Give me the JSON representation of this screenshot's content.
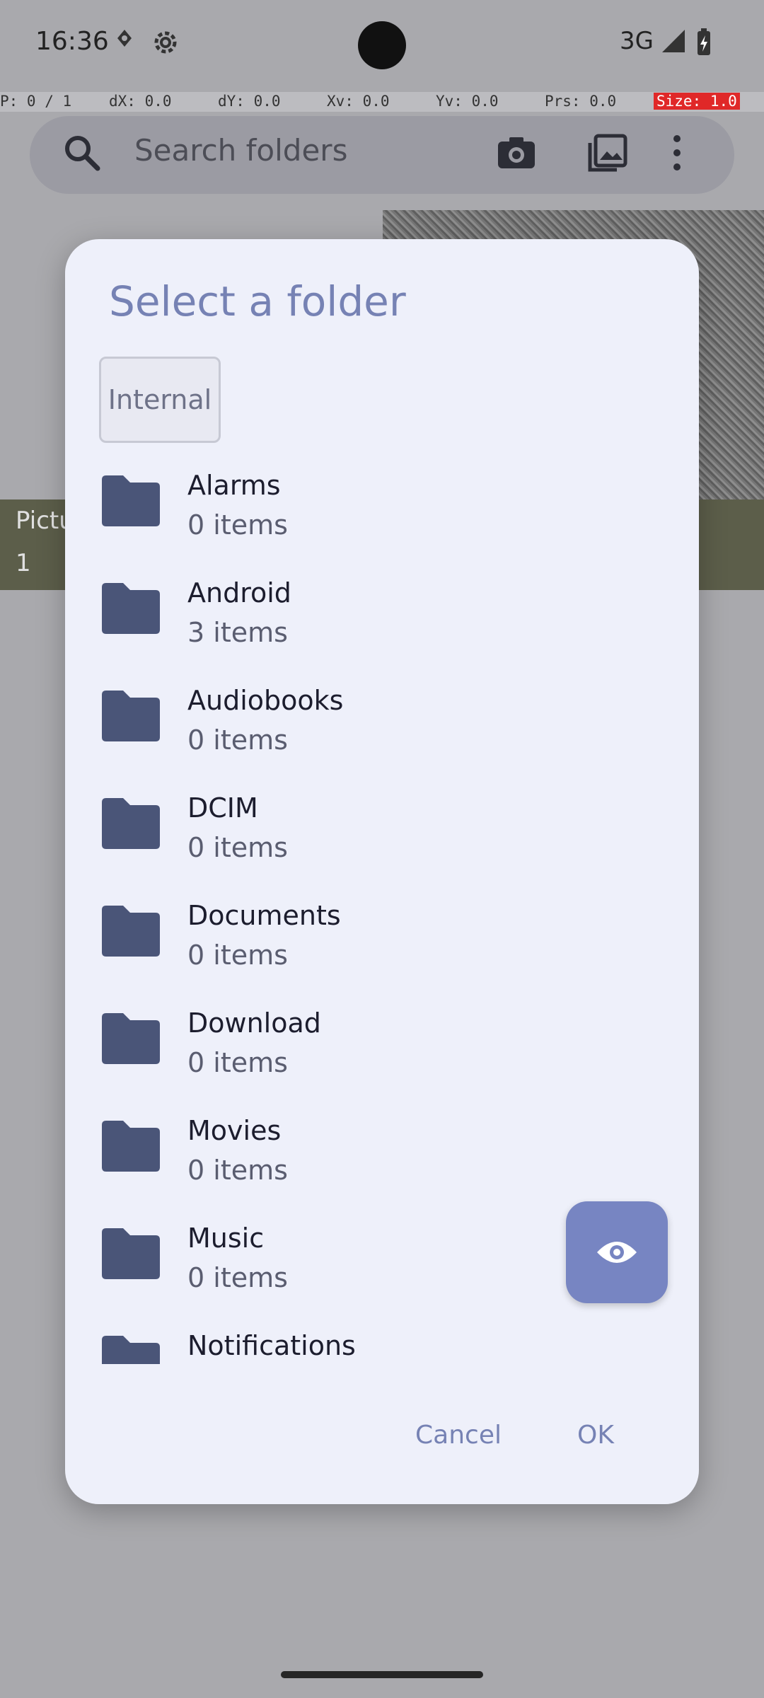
{
  "status_bar": {
    "time": "16:36",
    "network": "3G"
  },
  "pointer_info": {
    "p": "P: 0 / 1",
    "dx": "dX: 0.0",
    "dy": "dY: 0.0",
    "xv": "Xv: 0.0",
    "yv": "Yv: 0.0",
    "prs": "Prs: 0.0",
    "size": "Size: 1.0"
  },
  "search": {
    "placeholder": "Search folders"
  },
  "background": {
    "album_label": "Pictu",
    "album_count": "1"
  },
  "dialog": {
    "title": "Select a folder",
    "storage_chip": "Internal",
    "folders": [
      {
        "name": "Alarms",
        "count": "0 items"
      },
      {
        "name": "Android",
        "count": "3 items"
      },
      {
        "name": "Audiobooks",
        "count": "0 items"
      },
      {
        "name": "DCIM",
        "count": "0 items"
      },
      {
        "name": "Documents",
        "count": "0 items"
      },
      {
        "name": "Download",
        "count": "0 items"
      },
      {
        "name": "Movies",
        "count": "0 items"
      },
      {
        "name": "Music",
        "count": "0 items"
      },
      {
        "name": "Notifications",
        "count": ""
      }
    ],
    "cancel_label": "Cancel",
    "ok_label": "OK"
  },
  "colors": {
    "accent": "#7682b4",
    "folder_icon": "#4a5578",
    "dialog_bg": "#eef0fa"
  }
}
